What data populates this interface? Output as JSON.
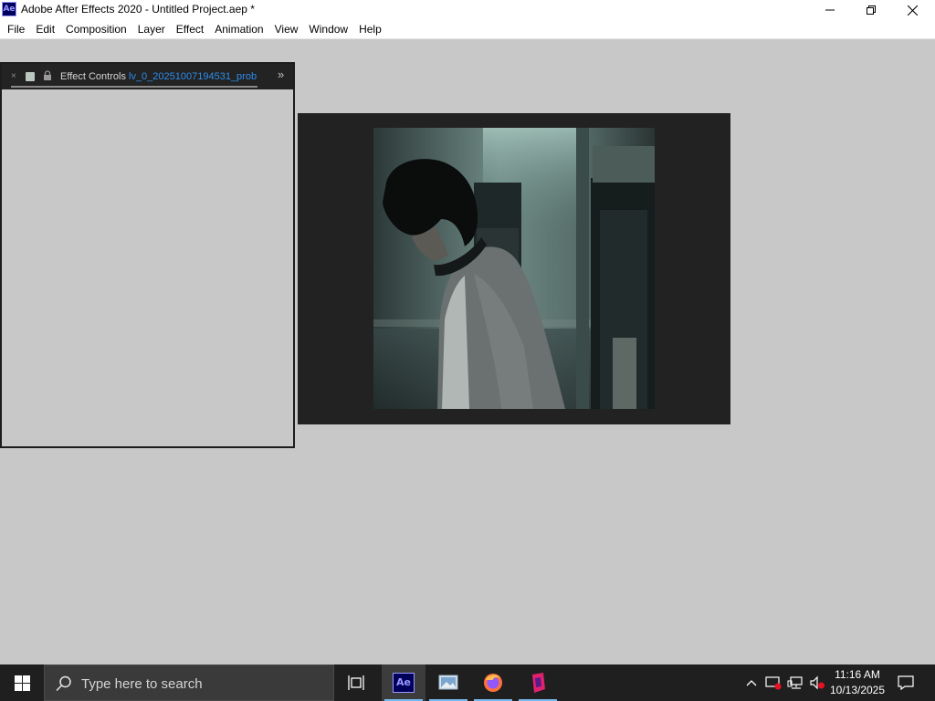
{
  "window": {
    "app_icon_label": "Ae",
    "title": "Adobe After Effects 2020 - Untitled Project.aep *",
    "controls": [
      "minimize-icon",
      "restore-icon",
      "close-icon"
    ]
  },
  "menu": {
    "items": [
      "File",
      "Edit",
      "Composition",
      "Layer",
      "Effect",
      "Animation",
      "View",
      "Window",
      "Help"
    ]
  },
  "effect_panel": {
    "close_glyph": "×",
    "title": "Effect Controls",
    "layer_name": "lv_0_20251007194531_prob",
    "more_glyph": "»",
    "swatch_color": "#b9c8c0",
    "layer_name_color": "#2d8ceb"
  },
  "viewer": {
    "background": "#222222",
    "frame_description_icon": "video-frame-image"
  },
  "taskbar": {
    "search_placeholder": "Type here to search",
    "apps": [
      {
        "name": "task-view-icon"
      },
      {
        "name": "after-effects-app",
        "label": "Ae",
        "active": true
      },
      {
        "name": "photos-app"
      },
      {
        "name": "firefox-app"
      },
      {
        "name": "pink-app"
      }
    ],
    "clock_time": "11:16 AM",
    "clock_date": "10/13/2025"
  }
}
